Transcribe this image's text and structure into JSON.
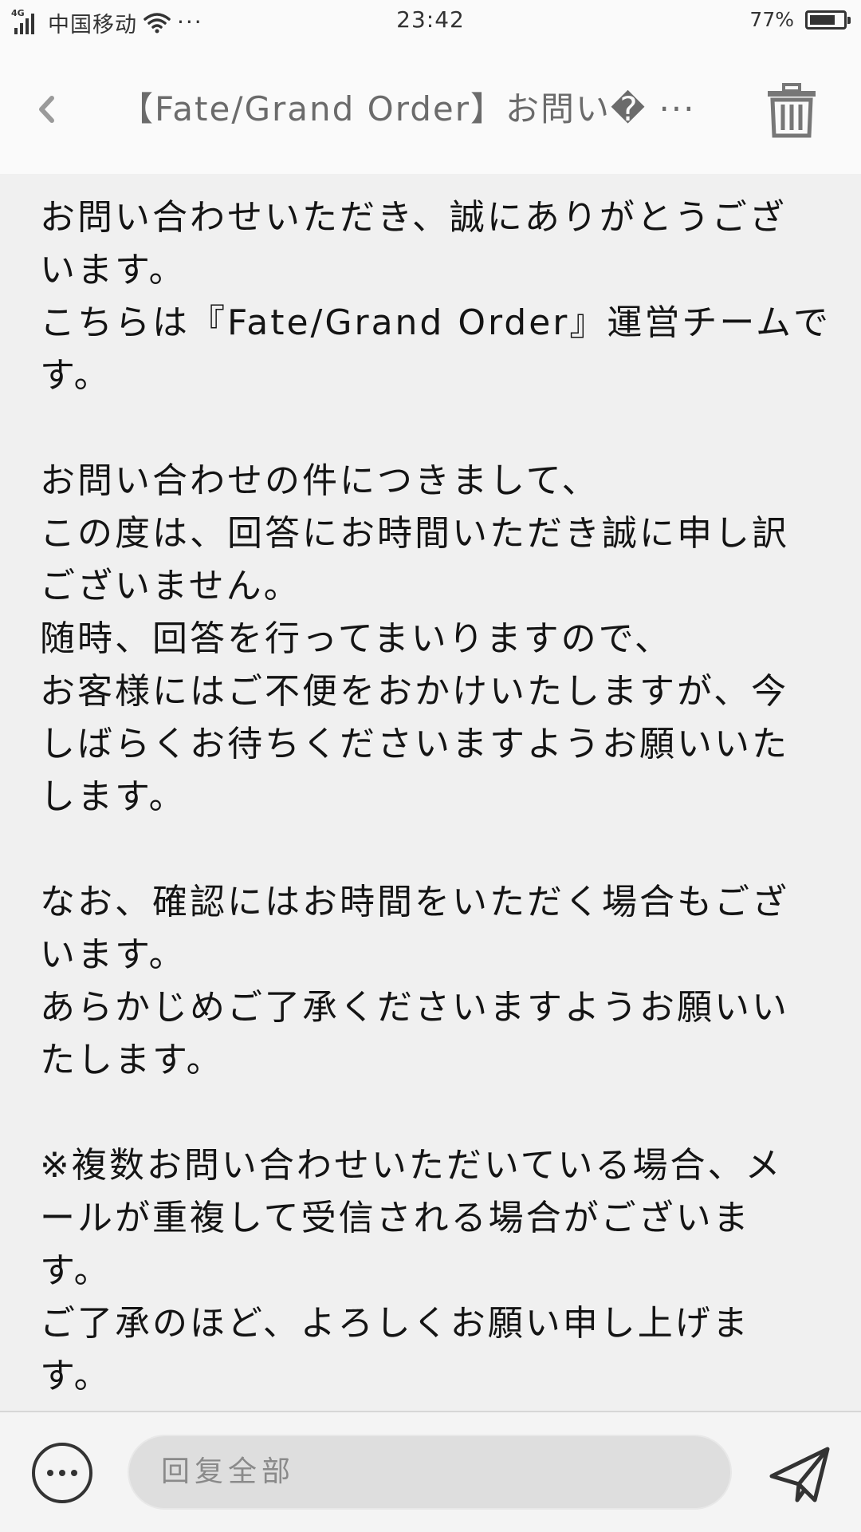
{
  "status_bar": {
    "network_type": "4G",
    "carrier": "中国移动",
    "more_indicator": "···",
    "time": "23:42",
    "battery_percent": "77%",
    "battery_level": 0.77
  },
  "nav": {
    "title": "【Fate/Grand Order】お問い� ···"
  },
  "message": {
    "lines": [
      "お問い合わせいただき、誠にありがとうござ",
      "います。",
      "こちらは『Fate/Grand Order』運営チームで",
      "す。",
      "",
      "お問い合わせの件につきまして、",
      "この度は、回答にお時間いただき誠に申し訳",
      "ございません。",
      "随時、回答を行ってまいりますので、",
      "お客様にはご不便をおかけいたしますが、今",
      "しばらくお待ちくださいますようお願いいた",
      "します。",
      "",
      "なお、確認にはお時間をいただく場合もござ",
      "います。",
      "あらかじめご了承くださいますようお願いい",
      "たします。",
      "",
      "※複数お問い合わせいただいている場合、メ",
      "ールが重複して受信される場合がございま",
      "す。",
      "ご了承のほど、よろしくお願い申し上げま",
      "す。"
    ]
  },
  "bottom_bar": {
    "reply_placeholder": "回复全部"
  },
  "icons": {
    "back": "chevron-left-icon",
    "trash": "trash-icon",
    "more": "more-options-icon",
    "send": "send-icon",
    "wifi": "wifi-icon",
    "battery": "battery-icon",
    "signal": "signal-icon"
  },
  "colors": {
    "background": "#f0f0f0",
    "bar_background": "#fafafa",
    "text": "#141414",
    "muted_text": "#6b6b6b",
    "icon": "#333333"
  }
}
